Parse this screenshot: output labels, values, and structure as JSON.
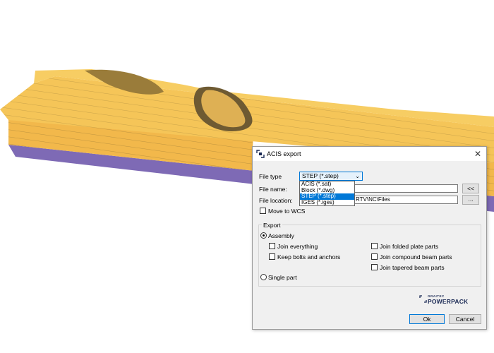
{
  "dialog": {
    "title": "ACIS export",
    "close_symbol": "✕",
    "file_type_label": "File type",
    "file_type_value": "STEP (*.step)",
    "file_type_options": [
      "ACIS (*.sat)",
      "Block (*.dwg)",
      "STEP (*.step)",
      "IGES (*.iges)"
    ],
    "file_type_selected_index": 2,
    "file_name_label": "File name:",
    "file_name_value": "",
    "file_name_button": "<<",
    "file_location_label": "File location:",
    "file_location_value": "RTV\\NC\\Files",
    "file_location_button": "...",
    "move_to_wcs_label": "Move to WCS",
    "export_group_label": "Export",
    "assembly_label": "Assembly",
    "join_everything_label": "Join everything",
    "keep_bolts_label": "Keep bolts and anchors",
    "join_folded_label": "Join folded plate parts",
    "join_compound_label": "Join compound beam parts",
    "join_tapered_label": "Join tapered beam parts",
    "single_part_label": "Single part",
    "brand_small": "GRAITEC",
    "brand_big": "POWERPACK",
    "ok_label": "Ok",
    "cancel_label": "Cancel"
  },
  "colors": {
    "beam_face": "#f2b84b",
    "beam_edge": "#7e6ab5",
    "accent": "#0078d7",
    "brand": "#1b2a55"
  }
}
